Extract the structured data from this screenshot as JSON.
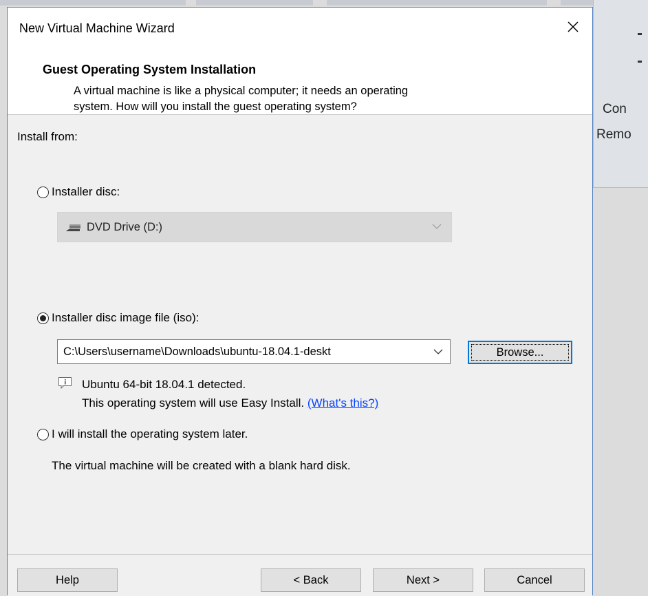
{
  "background": {
    "panel_line1": "Con",
    "panel_line2": "Remo"
  },
  "dialog": {
    "title": "New Virtual Machine Wizard",
    "close_label": "×"
  },
  "header": {
    "title": "Guest Operating System Installation",
    "description_line1": "A virtual machine is like a physical computer; it needs an operating",
    "description_line2": "system. How will you install the guest operating system?"
  },
  "body": {
    "install_from_label": "Install from:",
    "options": {
      "installer_disc": {
        "label": "Installer disc:",
        "selected": false,
        "drive_value": "DVD Drive (D:)",
        "enabled": false
      },
      "iso_file": {
        "label": "Installer disc image file (iso):",
        "selected": true,
        "path_value": "C:\\Users\\username\\Downloads\\ubuntu-18.04.1-deskt",
        "browse_label": "Browse...",
        "detected_text": "Ubuntu 64-bit 18.04.1 detected.",
        "easy_install_text": "This operating system will use Easy Install.",
        "whats_this_link": "(What's this?)"
      },
      "install_later": {
        "label": "I will install the operating system later.",
        "selected": false,
        "note": "The virtual machine will be created with a blank hard disk."
      }
    }
  },
  "footer": {
    "help_label": "Help",
    "back_label": "< Back",
    "next_label": "Next >",
    "cancel_label": "Cancel"
  },
  "colors": {
    "dialog_border": "#4f7ec2",
    "link": "#0645ff",
    "default_button_border": "#0078d7",
    "panel_bg": "#f0f0f0"
  }
}
